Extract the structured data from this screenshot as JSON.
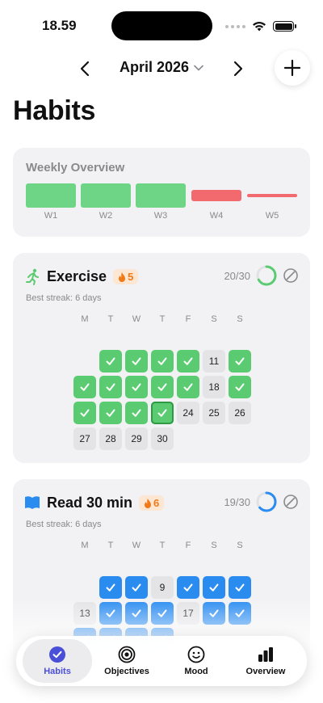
{
  "status": {
    "time": "18.59"
  },
  "month_nav": {
    "month": "April 2026"
  },
  "page": {
    "title": "Habits"
  },
  "weekly": {
    "title": "Weekly Overview",
    "weeks": [
      {
        "label": "W1",
        "status": "complete",
        "color": "#6fd586"
      },
      {
        "label": "W2",
        "status": "complete",
        "color": "#6fd586"
      },
      {
        "label": "W3",
        "status": "complete",
        "color": "#6fd586"
      },
      {
        "label": "W4",
        "status": "partial",
        "color": "#f26a6e"
      },
      {
        "label": "W5",
        "status": "low",
        "color": "#f26a6e"
      }
    ]
  },
  "weekdays": [
    "M",
    "T",
    "W",
    "T",
    "F",
    "S",
    "S"
  ],
  "habits": [
    {
      "name": "Exercise",
      "icon": "running-icon",
      "streak": "5",
      "count": "20/30",
      "progress": 0.667,
      "color": "#5bcb72",
      "best_streak": "Best streak: 6 days",
      "weeks": [
        [
          "",
          "done",
          "done",
          "done",
          "done",
          "11",
          "done"
        ],
        [
          "done",
          "done",
          "done",
          "done",
          "done",
          "18",
          "done"
        ],
        [
          "done",
          "done",
          "done",
          "today",
          "24",
          "25",
          "26"
        ],
        [
          "27",
          "28",
          "29",
          "30",
          "",
          "",
          ""
        ]
      ]
    },
    {
      "name": "Read 30 min",
      "icon": "book-icon",
      "streak": "6",
      "count": "19/30",
      "progress": 0.633,
      "color": "#2b8cf0",
      "best_streak": "Best streak: 6 days",
      "weeks": [
        [
          "",
          "done",
          "done",
          "9",
          "done",
          "done",
          "done"
        ],
        [
          "13",
          "done",
          "done",
          "done",
          "17",
          "done",
          "done"
        ],
        [
          "done",
          "done",
          "done",
          "done",
          "",
          "",
          ""
        ]
      ]
    }
  ],
  "tabs": [
    {
      "label": "Habits",
      "icon": "checkmark-circle-icon",
      "active": true
    },
    {
      "label": "Objectives",
      "icon": "target-icon",
      "active": false
    },
    {
      "label": "Mood",
      "icon": "smiley-icon",
      "active": false
    },
    {
      "label": "Overview",
      "icon": "bar-chart-icon",
      "active": false
    }
  ]
}
